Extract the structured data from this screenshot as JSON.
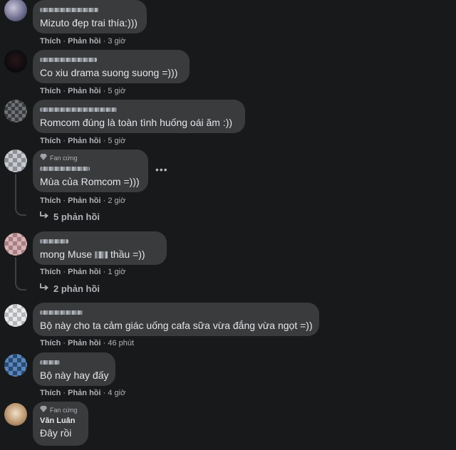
{
  "comments": [
    {
      "text": "Mizuto đẹp trai thía:)))",
      "like": "Thích",
      "reply": "Phản hồi",
      "time": "3 giờ"
    },
    {
      "text": "Co xiu drama suong suong =)))",
      "like": "Thích",
      "reply": "Phản hồi",
      "time": "5 giờ"
    },
    {
      "text": "Romcom đúng là toàn tình huống oái ăm :))",
      "like": "Thích",
      "reply": "Phản hồi",
      "time": "5 giờ"
    },
    {
      "badge": "Fan cứng",
      "text": "Mùa của Romcom =)))",
      "like": "Thích",
      "reply": "Phản hồi",
      "time": "2 giờ",
      "replies": "5 phản hồi"
    },
    {
      "text_before": "mong Muse",
      "text_after": "thầu =))",
      "like": "Thích",
      "reply": "Phản hồi",
      "time": "1 giờ",
      "replies": "2 phản hồi"
    },
    {
      "text": "Bộ này cho ta cảm giác uống cafa sữa vừa đắng vừa ngọt =))",
      "like": "Thích",
      "reply": "Phản hồi",
      "time": "46 phút"
    },
    {
      "text": "Bộ này hay đấy",
      "like": "Thích",
      "reply": "Phản hồi",
      "time": "4 giờ"
    },
    {
      "badge": "Fan cứng",
      "name": "Văn Luân",
      "text": "Đây rồi"
    }
  ],
  "colors": {
    "background": "#18191a",
    "bubble": "#3a3b3c",
    "text": "#e4e6eb",
    "muted": "#b0b3b8"
  },
  "icons": {
    "reply_arrow": "reply-arrow-icon",
    "badge": "diamond-icon",
    "more": "more-options-icon"
  }
}
